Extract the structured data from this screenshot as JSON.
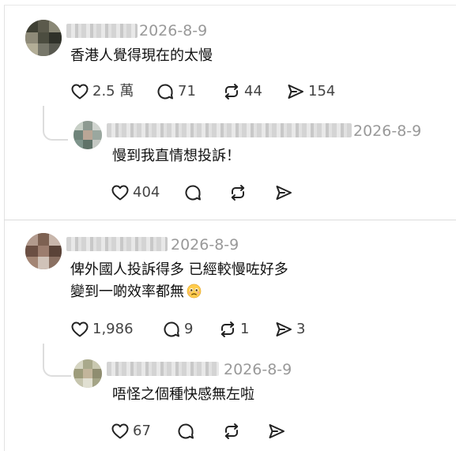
{
  "comments": [
    {
      "date": "2026-8-9",
      "text": "香港人覺得現在的太慢",
      "likes": "2.5 萬",
      "replies": "71",
      "reposts": "44",
      "shares": "154",
      "reply": {
        "date": "2026-8-9",
        "text": "慢到我直情想投訴！",
        "likes": "404"
      }
    },
    {
      "date": "2026-8-9",
      "text_line1": "俾外國人投訴得多 已經較慢咗好多",
      "text_line2": "變到一啲效率都無",
      "likes": "1,986",
      "replies": "9",
      "reposts": "1",
      "shares": "3",
      "reply": {
        "date": "2026-8-9",
        "text": "唔怪之個種快感無左啦",
        "likes": "67"
      }
    }
  ],
  "icons": {
    "like": "heart-icon",
    "reply": "speech-bubble-icon",
    "repost": "repost-icon",
    "share": "send-icon",
    "emoji": "pleading-face-emoji"
  },
  "colors": {
    "text": "#101010",
    "muted": "#999999",
    "icon": "#222222",
    "divider": "#dcdcdc"
  }
}
